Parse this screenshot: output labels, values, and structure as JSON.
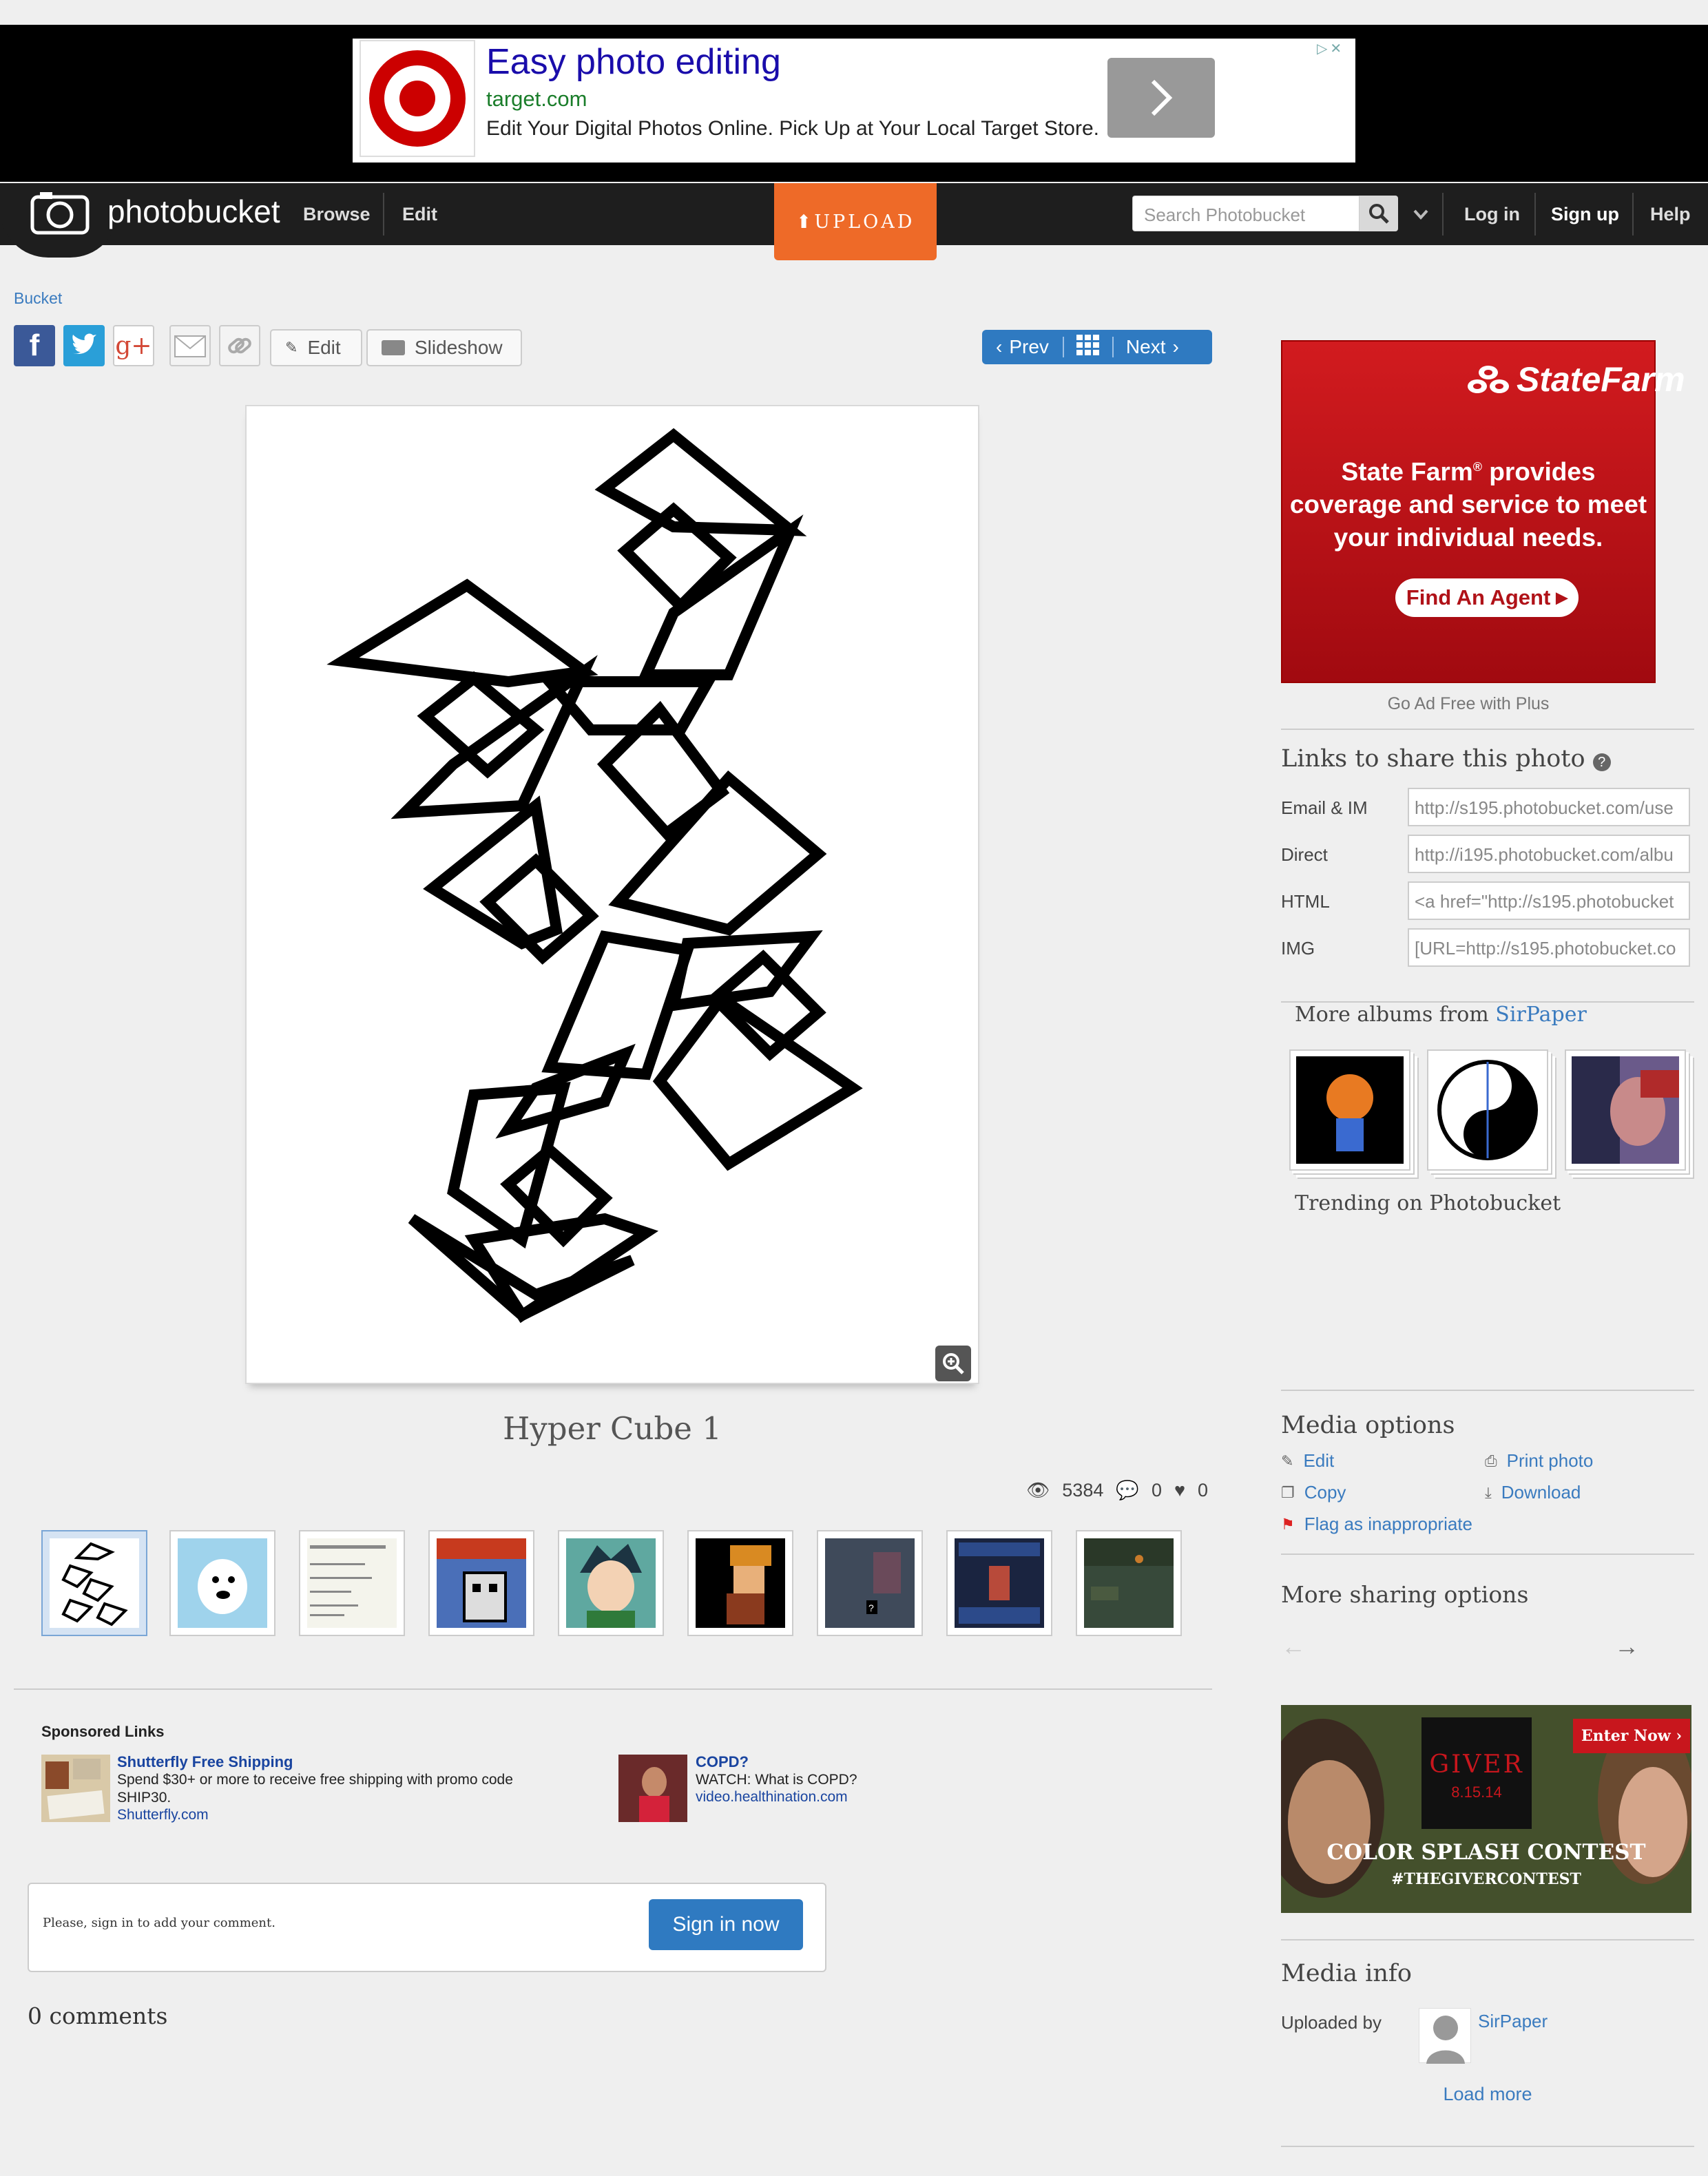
{
  "top_ad": {
    "headline": "Easy photo editing",
    "url": "target.com",
    "description": "Edit Your Digital Photos Online. Pick Up at Your Local Target Store."
  },
  "nav": {
    "brand": "photobucket",
    "browse": "Browse",
    "edit": "Edit",
    "upload": "UPLOAD",
    "search_placeholder": "Search Photobucket",
    "login": "Log in",
    "signup": "Sign up",
    "help": "Help"
  },
  "breadcrumb": "Bucket",
  "toolbar": {
    "edit": "Edit",
    "slideshow": "Slideshow",
    "prev": "Prev",
    "next": "Next"
  },
  "photo": {
    "title": "Hyper Cube 1",
    "views": "5384",
    "comments": "0",
    "likes": "0"
  },
  "thumbnails": [
    {
      "name": "hypercube",
      "selected": true
    },
    {
      "name": "toilet-paper"
    },
    {
      "name": "rewards-page"
    },
    {
      "name": "mega-man"
    },
    {
      "name": "anime-boy"
    },
    {
      "name": "pixel-character"
    },
    {
      "name": "game-scene"
    },
    {
      "name": "game-ui"
    },
    {
      "name": "game-map"
    }
  ],
  "sponsored": {
    "heading": "Sponsored Links",
    "ads": [
      {
        "title": "Shutterfly Free Shipping",
        "text": "Spend $30+ or more to receive free shipping with promo code SHIP30.",
        "url": "Shutterfly.com"
      },
      {
        "title": "COPD?",
        "text": "WATCH: What is COPD?",
        "url": "video.healthination.com"
      }
    ]
  },
  "comments": {
    "prompt": "Please, sign in to add your comment.",
    "signin": "Sign in now",
    "count": "0 comments"
  },
  "sidebar": {
    "statefarm": {
      "brand": "StateFarm",
      "line1": "State Farm",
      "line2": " provides",
      "line3": "coverage and service to meet",
      "line4": "your individual needs.",
      "cta": "Find An Agent"
    },
    "ad_free": "Go Ad Free with Plus",
    "links_heading": "Links to share this photo",
    "links": [
      {
        "label": "Email & IM",
        "value": "http://s195.photobucket.com/use"
      },
      {
        "label": "Direct",
        "value": "http://i195.photobucket.com/albu"
      },
      {
        "label": "HTML",
        "value": "<a href=\"http://s195.photobucket"
      },
      {
        "label": "IMG",
        "value": "[URL=http://s195.photobucket.co"
      }
    ],
    "more_albums_prefix": "More albums from ",
    "more_albums_user": "SirPaper",
    "trending": "Trending on Photobucket",
    "media_options": {
      "heading": "Media options",
      "edit": "Edit",
      "copy": "Copy",
      "flag": "Flag as inappropriate",
      "print": "Print photo",
      "download": "Download"
    },
    "more_sharing": "More sharing options",
    "giver_ad": {
      "enter": "Enter Now",
      "title": "GIVER",
      "date": "8.15.14",
      "line1": "COLOR SPLASH CONTEST",
      "line2": "#THEGIVERCONTEST"
    },
    "media_info": {
      "heading": "Media info",
      "uploaded_by": "Uploaded by",
      "user": "SirPaper",
      "load_more": "Load more"
    }
  },
  "colors": {
    "accent_blue": "#2f7ac1",
    "upload_orange": "#ee6a28",
    "nav_bg": "#1e1e1e",
    "statefarm_red": "#c8161d"
  }
}
